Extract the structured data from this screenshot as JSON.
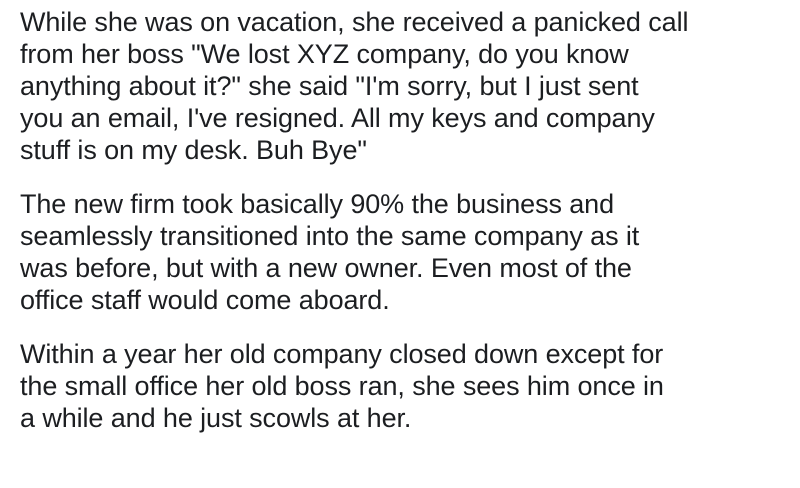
{
  "post": {
    "paragraphs": [
      "While she was on vacation, she received a panicked call\nfrom her boss \"We lost XYZ company, do you know\nanything about it?\"  she said \"I'm sorry, but I just sent\nyou an email, I've resigned. All my keys and company\nstuff is on my desk. Buh Bye\"",
      "The new firm took basically 90% the business and\nseamlessly transitioned into the same company as it\nwas before, but with a new owner. Even most of the\noffice staff would come aboard.",
      "Within a year her old company closed down except for\nthe small office her old boss ran, she sees him once in\na while and he just scowls at her."
    ]
  }
}
